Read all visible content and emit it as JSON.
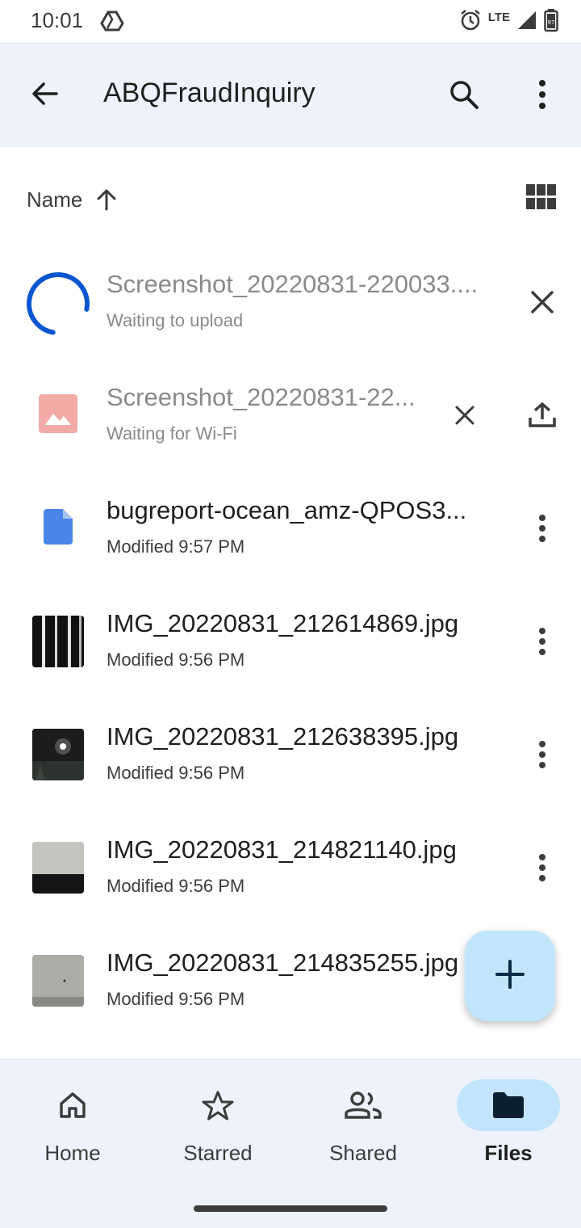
{
  "status_bar": {
    "time": "10:01",
    "network": "LTE",
    "battery": "97"
  },
  "app_bar": {
    "title": "ABQFraudInquiry"
  },
  "sort": {
    "label": "Name"
  },
  "files": [
    {
      "name": "Screenshot_20220831-220033....",
      "sub": "Waiting to upload",
      "state": "uploading"
    },
    {
      "name": "Screenshot_20220831-22...",
      "sub": "Waiting for Wi-Fi",
      "state": "waiting-wifi"
    },
    {
      "name": "bugreport-ocean_amz-QPOS3...",
      "sub": "Modified 9:57 PM",
      "state": "done"
    },
    {
      "name": "IMG_20220831_212614869.jpg",
      "sub": "Modified 9:56 PM",
      "state": "done"
    },
    {
      "name": "IMG_20220831_212638395.jpg",
      "sub": "Modified 9:56 PM",
      "state": "done"
    },
    {
      "name": "IMG_20220831_214821140.jpg",
      "sub": "Modified 9:56 PM",
      "state": "done"
    },
    {
      "name": "IMG_20220831_214835255.jpg",
      "sub": "Modified 9:56 PM",
      "state": "done"
    }
  ],
  "nav": [
    {
      "label": "Home",
      "icon": "home-icon"
    },
    {
      "label": "Starred",
      "icon": "star-icon"
    },
    {
      "label": "Shared",
      "icon": "people-icon"
    },
    {
      "label": "Files",
      "icon": "folder-icon",
      "active": true
    }
  ],
  "colors": {
    "app_bar_bg": "#eef2fa",
    "accent": "#0b57d0",
    "active_pill": "#c2e5fb"
  }
}
